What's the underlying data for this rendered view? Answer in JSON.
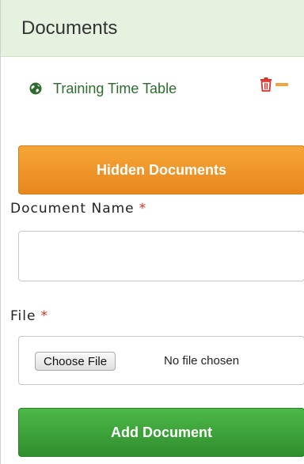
{
  "panel": {
    "title": "Documents"
  },
  "documents": [
    {
      "name": "Training Time Table",
      "icon": "globe-icon"
    }
  ],
  "buttons": {
    "hidden_documents": "Hidden Documents",
    "add_document": "Add Document"
  },
  "form": {
    "document_name_label": "Document Name",
    "file_label": "File",
    "required_marker": "*",
    "document_name_value": "",
    "choose_file_label": "Choose File",
    "file_status": "No file chosen"
  },
  "colors": {
    "header_bg": "#e6f2df",
    "link_green": "#2e6b2e",
    "orange_button": "#f0a43b",
    "green_button": "#3aa03a",
    "delete_red": "#d9342b"
  }
}
